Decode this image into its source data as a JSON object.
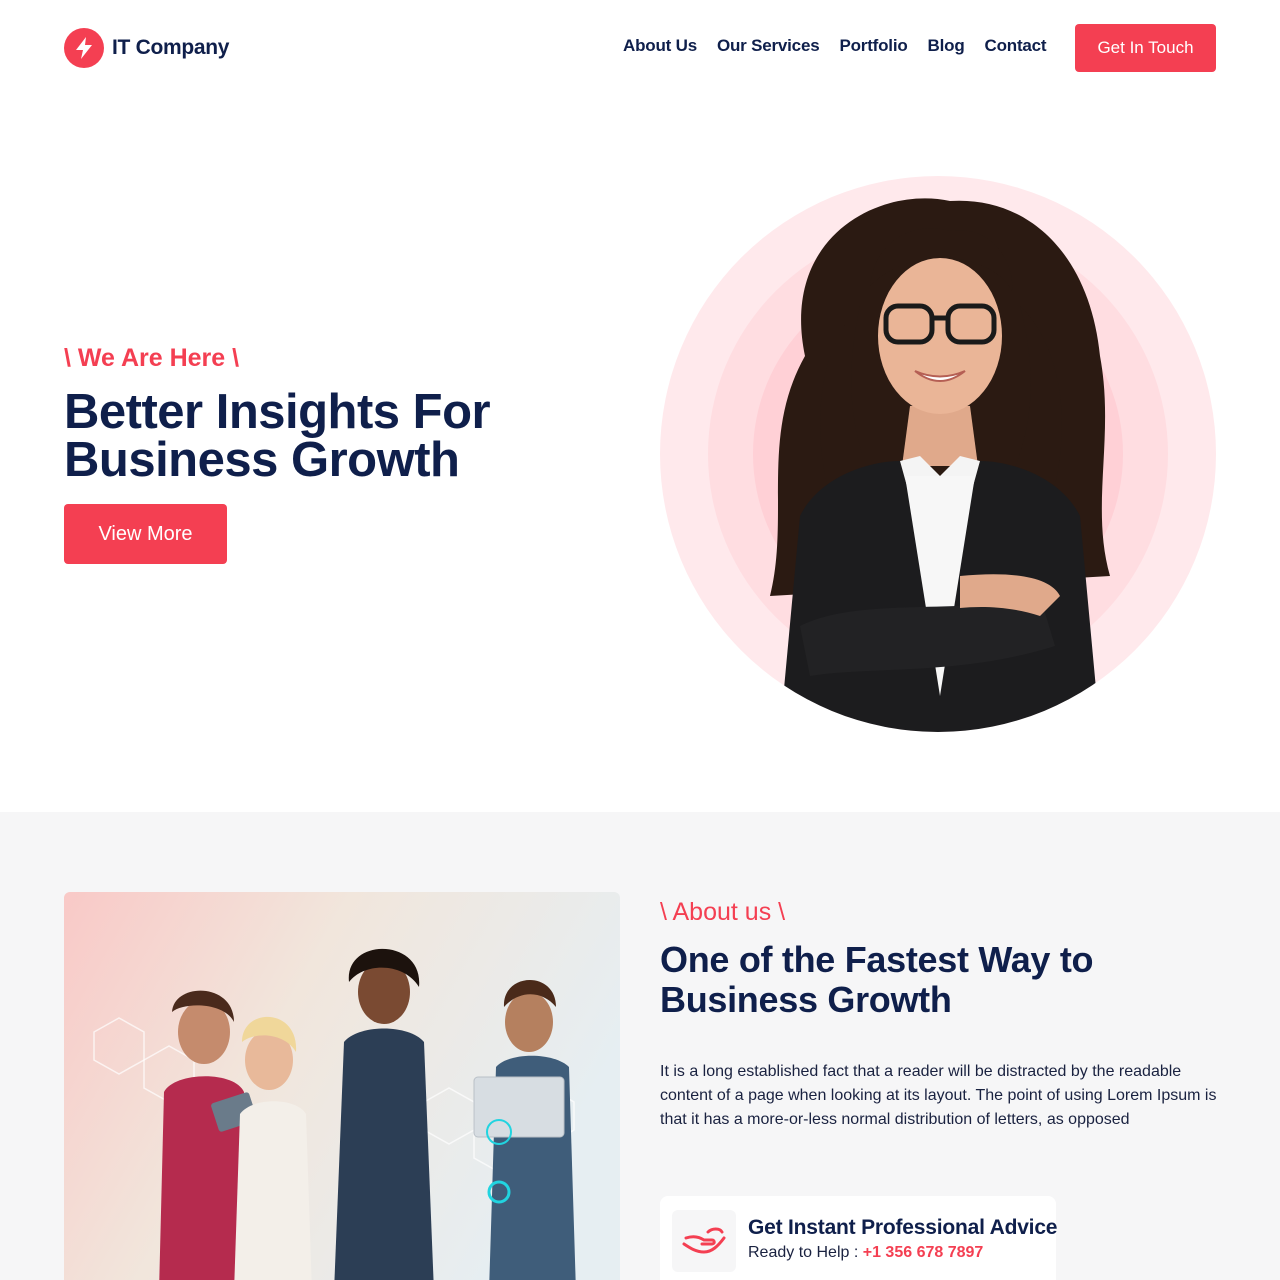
{
  "brand": {
    "name": "IT Company",
    "icon": "lightning-bolt-icon",
    "accent_color": "#f43f52",
    "navy_color": "#0f1f4b"
  },
  "nav": {
    "items": [
      {
        "label": "About Us"
      },
      {
        "label": "Our Services"
      },
      {
        "label": "Portfolio"
      },
      {
        "label": "Blog"
      },
      {
        "label": "Contact"
      }
    ],
    "cta_label": "Get In Touch"
  },
  "hero": {
    "tagline": "\\ We Are Here \\",
    "title": "Better Insights For Business Growth",
    "button_label": "View More",
    "image": "smiling-businesswoman-portrait"
  },
  "about": {
    "tagline": "\\ About us \\",
    "title": "One of the Fastest Way to Business Growth",
    "paragraph": "It is a long established fact that a reader will be distracted by the readable content of a page when looking at its layout. The point of using Lorem Ipsum is that it has a more-or-less normal distribution of letters, as opposed",
    "image": "team-with-devices-photo",
    "advice": {
      "icon": "helping-hand-icon",
      "title": "Get Instant Professional Advice",
      "prefix": "Ready to Help : ",
      "phone": "+1 356 678 7897"
    }
  }
}
